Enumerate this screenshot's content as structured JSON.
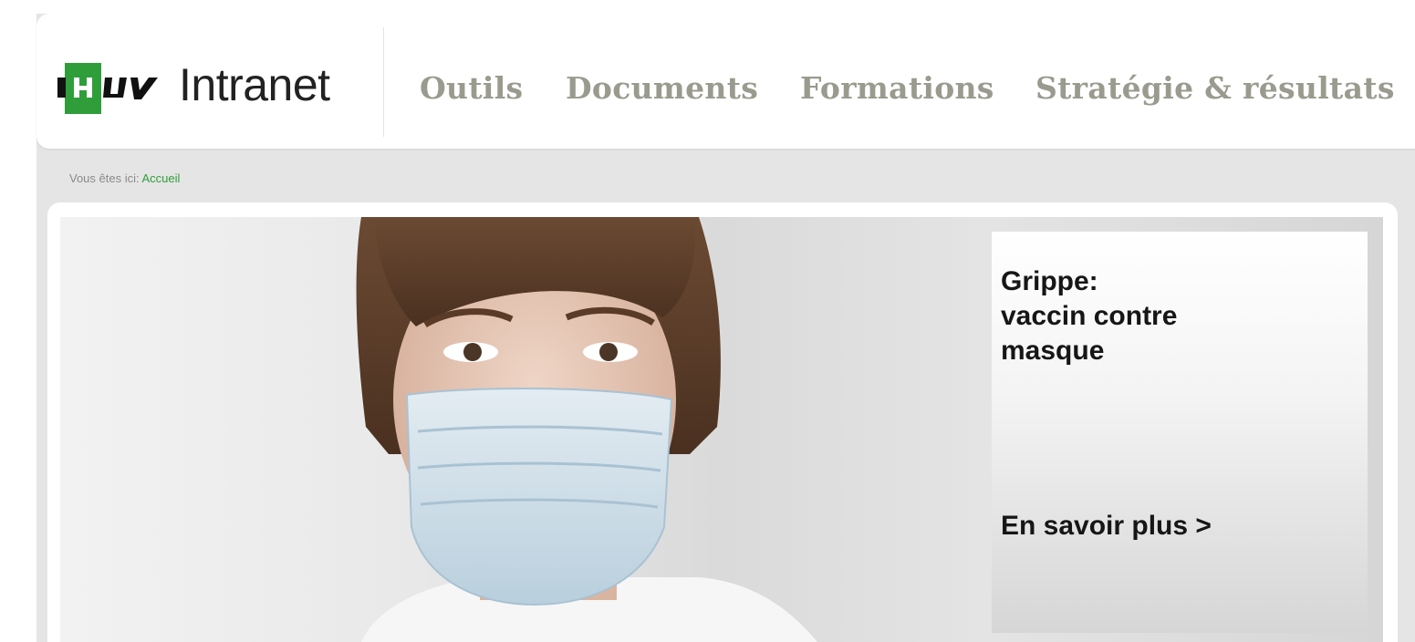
{
  "logo": {
    "mark": "CHUV",
    "text": "Intranet"
  },
  "nav": [
    "Outils",
    "Documents",
    "Formations",
    "Stratégie & résultats"
  ],
  "breadcrumb": {
    "prefix": "Vous êtes ici:",
    "current": "Accueil"
  },
  "hero": {
    "title_lines": [
      "Grippe:",
      "vaccin contre",
      "masque"
    ],
    "cta": "En savoir plus >"
  },
  "colors": {
    "brand_green": "#2f9e3a",
    "nav_text": "#9a9a8e",
    "page_bg": "#e5e5e5"
  }
}
